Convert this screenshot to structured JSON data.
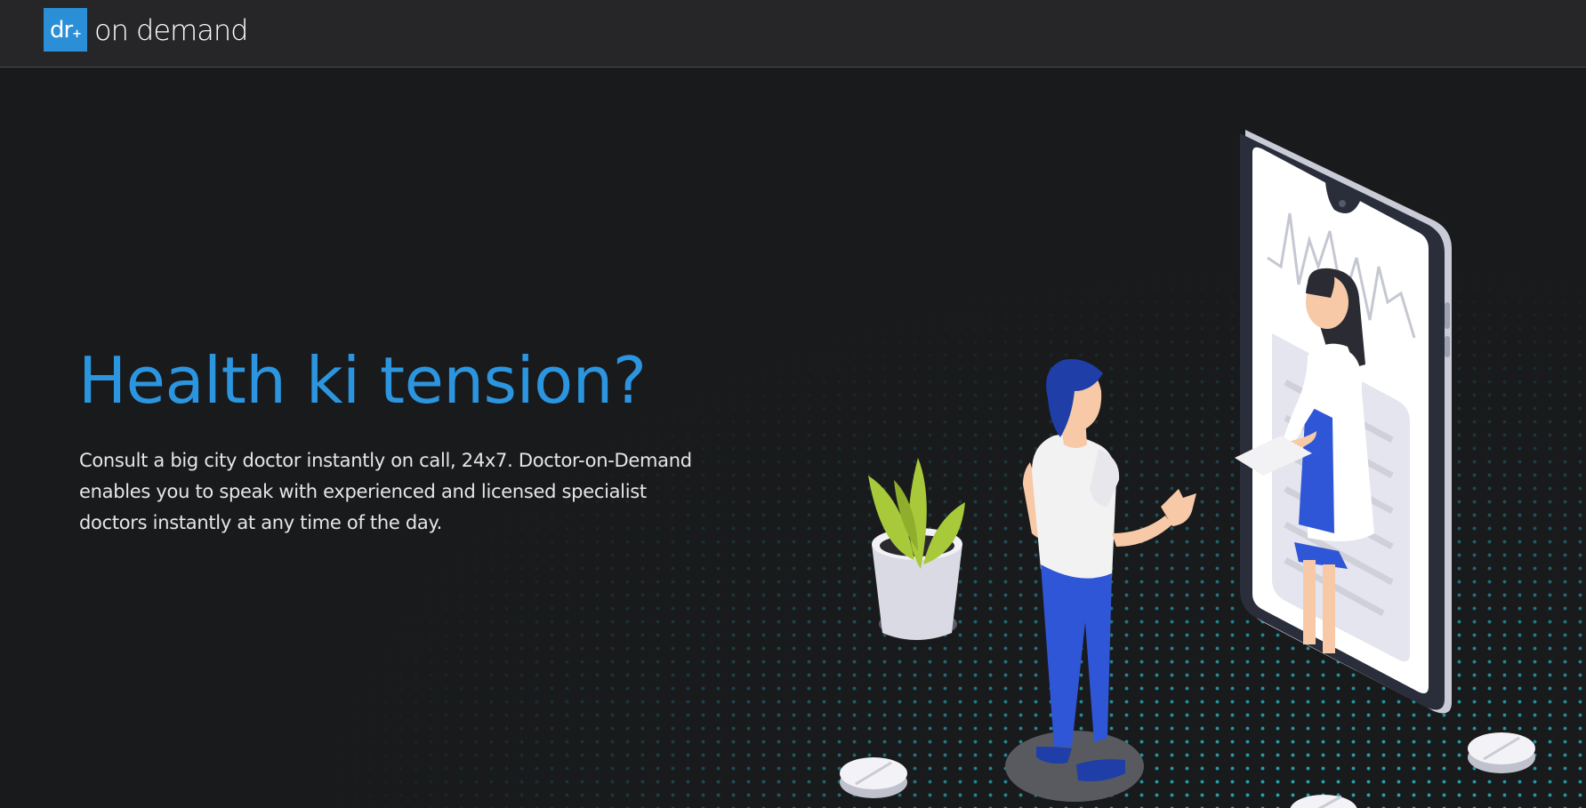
{
  "header": {
    "logo_mark": "dr",
    "logo_plus": "+",
    "logo_text": "on demand"
  },
  "hero": {
    "headline": "Health ki tension?",
    "description": "Consult a big city doctor instantly on call, 24x7. Doctor-on-Demand enables you to speak with experienced and licensed specialist doctors instantly at any time of the day."
  },
  "colors": {
    "brand_blue": "#2a8fd6",
    "headline_blue": "#2c95df",
    "background": "#191a1c",
    "header_bg": "#262629",
    "dot_accent": "#2cc6d8"
  },
  "icons": [
    "doctor-on-phone-illustration",
    "patient-illustration",
    "plant-icon",
    "pill-icon"
  ]
}
